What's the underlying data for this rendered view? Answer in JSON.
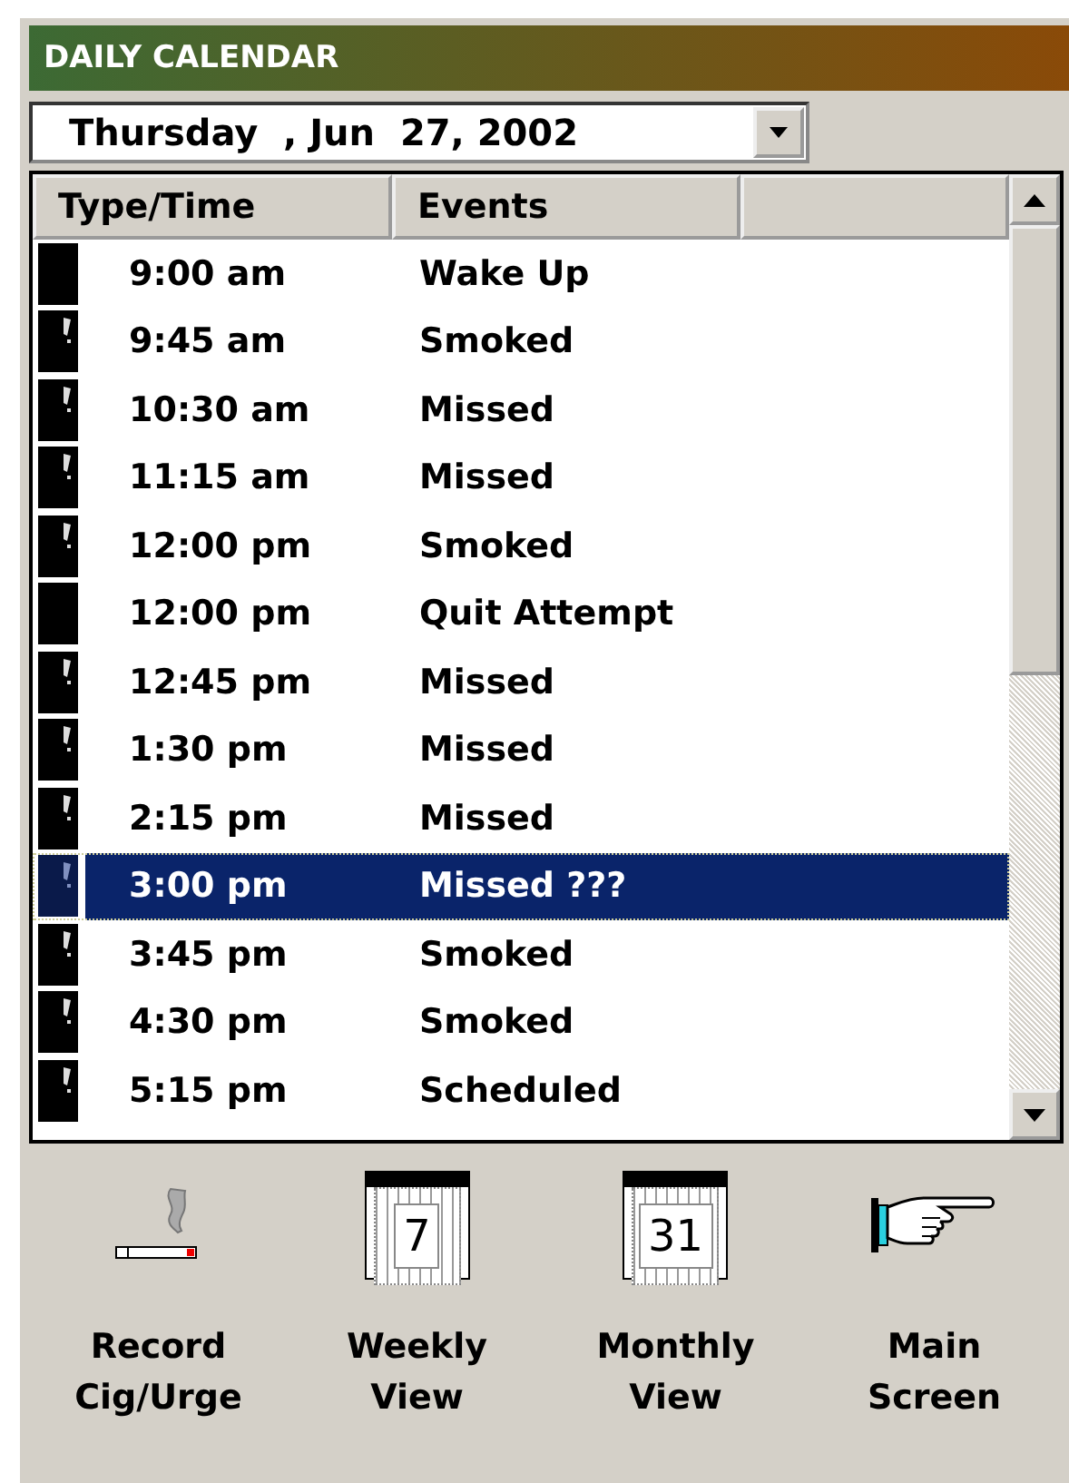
{
  "window": {
    "title": "DAILY CALENDAR"
  },
  "date_picker": {
    "value": "Thursday  , Jun  27, 2002"
  },
  "table": {
    "columns": [
      "Type/Time",
      "Events"
    ],
    "rows": [
      {
        "kind": "plain",
        "time": "9:00 am",
        "event": "Wake Up",
        "selected": false
      },
      {
        "kind": "alert",
        "time": "9:45 am",
        "event": "Smoked",
        "selected": false
      },
      {
        "kind": "alert",
        "time": "10:30 am",
        "event": "Missed",
        "selected": false
      },
      {
        "kind": "alert",
        "time": "11:15 am",
        "event": "Missed",
        "selected": false
      },
      {
        "kind": "alert",
        "time": "12:00 pm",
        "event": "Smoked",
        "selected": false
      },
      {
        "kind": "plain",
        "time": "12:00 pm",
        "event": "Quit Attempt",
        "selected": false
      },
      {
        "kind": "alert",
        "time": "12:45 pm",
        "event": "Missed",
        "selected": false
      },
      {
        "kind": "alert",
        "time": "1:30 pm",
        "event": "Missed",
        "selected": false
      },
      {
        "kind": "alert",
        "time": "2:15 pm",
        "event": "Missed",
        "selected": false
      },
      {
        "kind": "alert",
        "time": "3:00 pm",
        "event": "Missed ???",
        "selected": true
      },
      {
        "kind": "alert",
        "time": "3:45 pm",
        "event": "Smoked",
        "selected": false
      },
      {
        "kind": "alert",
        "time": "4:30 pm",
        "event": "Smoked",
        "selected": false
      },
      {
        "kind": "alert",
        "time": "5:15 pm",
        "event": "Scheduled",
        "selected": false
      }
    ]
  },
  "actions": [
    {
      "kind": "cigarette",
      "label": "Record\nCig/Urge"
    },
    {
      "kind": "calendar",
      "icon_text": "7",
      "label": "Weekly\nView"
    },
    {
      "kind": "calendar",
      "icon_text": "31",
      "label": "Monthly\nView"
    },
    {
      "kind": "hand",
      "label": "Main\nScreen"
    }
  ]
}
